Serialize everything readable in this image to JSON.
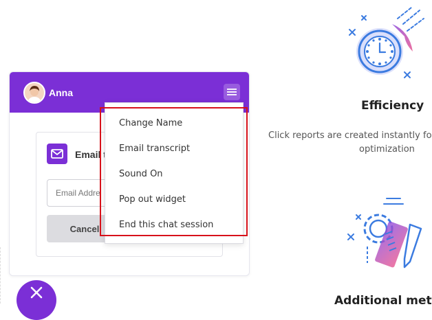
{
  "chat": {
    "agent_name": "Anna",
    "email_title": "Email t",
    "email_placeholder": "Email Addre",
    "cancel_label": "Cancel"
  },
  "menu": {
    "items": [
      {
        "label": "Change Name"
      },
      {
        "label": "Email transcript"
      },
      {
        "label": "Sound On"
      },
      {
        "label": "Pop out widget"
      },
      {
        "label": "End this chat session"
      }
    ]
  },
  "features": {
    "efficiency": {
      "title": "Efficiency",
      "desc_line1": "Click reports are created instantly for",
      "desc_line2": "optimization"
    },
    "additional": {
      "title": "Additional metr"
    }
  },
  "colors": {
    "brand_purple": "#7b2fd6",
    "highlight_red": "#d7111a",
    "icon_blue": "#3b7be0"
  },
  "icons": [
    "menu-icon",
    "envelope-icon",
    "close-icon",
    "clock-icon",
    "gear-icon",
    "ruler-pencil-icon"
  ]
}
